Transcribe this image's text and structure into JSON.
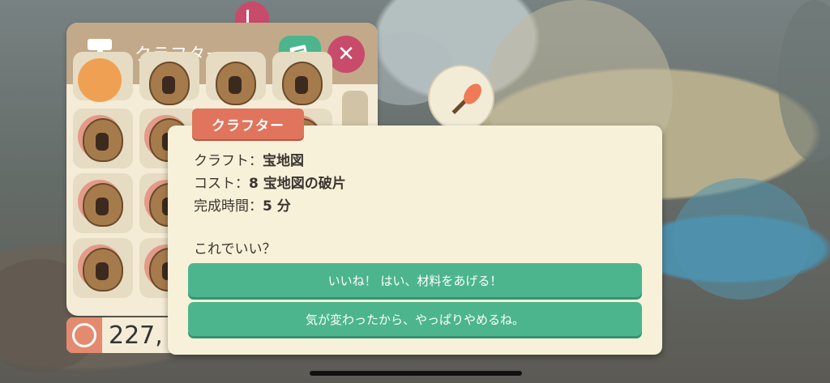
{
  "panel": {
    "title": "クラフター",
    "counter_value": "227,"
  },
  "dialog": {
    "tag": "クラフター",
    "craft_label": "クラフト：",
    "craft_value": "宝地図",
    "cost_label": "コスト：",
    "cost_value": "8 宝地図の破片",
    "time_label": "完成時間：",
    "time_value": "5 分",
    "question": "これでいい？",
    "choices": [
      "いいね！ はい、材料をあげる！",
      "気が変わったから、やっぱりやめるね。"
    ]
  },
  "icons": {
    "header": "hammer-icon",
    "notes": "notes-icon",
    "close": "close-icon",
    "currency": "bells-icon",
    "item": "bug-net-icon"
  },
  "colors": {
    "accent_green": "#4cb58e",
    "close_red": "#c94b6b",
    "tag_orange": "#e0745c",
    "panel_bg": "#f4ecd6",
    "header_bg": "#c1a98a"
  }
}
